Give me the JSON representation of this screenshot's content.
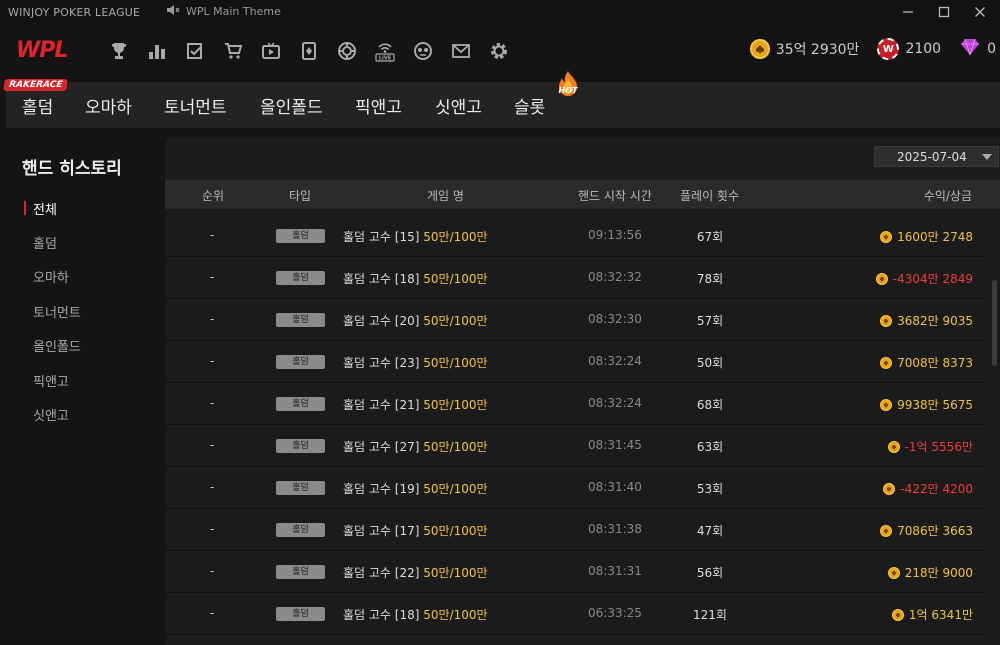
{
  "app": {
    "title": "WINJOY POKER LEAGUE",
    "theme": "WPL Main Theme",
    "logo": "WPL"
  },
  "nav_icons": [
    "trophy-icon",
    "ranking-icon",
    "checklist-icon",
    "cart-icon",
    "tv-icon",
    "cards-icon",
    "chip-icon",
    "live-icon",
    "emote-icon",
    "mail-icon",
    "settings-icon"
  ],
  "currencies": {
    "gold": "35억 2930만",
    "w_chip": "2100",
    "gem": "0"
  },
  "tabs": {
    "rake_badge": "RAKERACE",
    "hot_badge": "HOT",
    "items": [
      "홀덤",
      "오마하",
      "토너먼트",
      "올인폴드",
      "픽앤고",
      "싯앤고",
      "슬롯"
    ]
  },
  "sidebar": {
    "title": "핸드 히스토리",
    "items": [
      "전체",
      "홀덤",
      "오마하",
      "토너먼트",
      "올인폴드",
      "픽앤고",
      "싯앤고"
    ],
    "active_index": 0
  },
  "date_filter": "2025-07-04",
  "table": {
    "headers": [
      "순위",
      "타입",
      "게임 명",
      "핸드 시작 시간",
      "플레이 횟수",
      "수익/상금"
    ],
    "rows": [
      {
        "rank": "-",
        "type": "홀덤",
        "name": "홀덤 고수 [15]",
        "stakes": "50만/100만",
        "time": "09:13:56",
        "plays": "67회",
        "profit": "1600만 2748",
        "negative": false
      },
      {
        "rank": "-",
        "type": "홀덤",
        "name": "홀덤 고수 [18]",
        "stakes": "50만/100만",
        "time": "08:32:32",
        "plays": "78회",
        "profit": "-4304만 2849",
        "negative": true
      },
      {
        "rank": "-",
        "type": "홀덤",
        "name": "홀덤 고수 [20]",
        "stakes": "50만/100만",
        "time": "08:32:30",
        "plays": "57회",
        "profit": "3682만 9035",
        "negative": false
      },
      {
        "rank": "-",
        "type": "홀덤",
        "name": "홀덤 고수 [23]",
        "stakes": "50만/100만",
        "time": "08:32:24",
        "plays": "50회",
        "profit": "7008만 8373",
        "negative": false
      },
      {
        "rank": "-",
        "type": "홀덤",
        "name": "홀덤 고수 [21]",
        "stakes": "50만/100만",
        "time": "08:32:24",
        "plays": "68회",
        "profit": "9938만 5675",
        "negative": false
      },
      {
        "rank": "-",
        "type": "홀덤",
        "name": "홀덤 고수 [27]",
        "stakes": "50만/100만",
        "time": "08:31:45",
        "plays": "63회",
        "profit": "-1억 5556만",
        "negative": true
      },
      {
        "rank": "-",
        "type": "홀덤",
        "name": "홀덤 고수 [19]",
        "stakes": "50만/100만",
        "time": "08:31:40",
        "plays": "53회",
        "profit": "-422만 4200",
        "negative": true
      },
      {
        "rank": "-",
        "type": "홀덤",
        "name": "홀덤 고수 [17]",
        "stakes": "50만/100만",
        "time": "08:31:38",
        "plays": "47회",
        "profit": "7086만 3663",
        "negative": false
      },
      {
        "rank": "-",
        "type": "홀덤",
        "name": "홀덤 고수 [22]",
        "stakes": "50만/100만",
        "time": "08:31:31",
        "plays": "56회",
        "profit": "218만 9000",
        "negative": false
      },
      {
        "rank": "-",
        "type": "홀덤",
        "name": "홀덤 고수 [18]",
        "stakes": "50만/100만",
        "time": "06:33:25",
        "plays": "121회",
        "profit": "1억 6341만",
        "negative": false
      }
    ]
  },
  "colors": {
    "accent_red": "#e0242b",
    "gold_text": "#f0c43a",
    "negative_text": "#ef3b3b"
  }
}
